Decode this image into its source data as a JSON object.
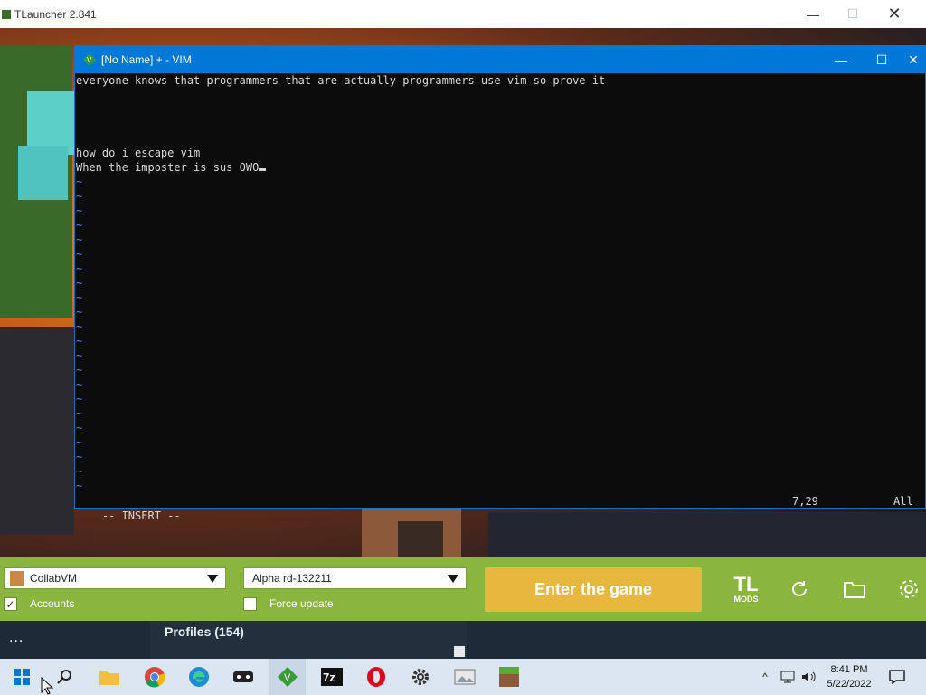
{
  "tlauncher": {
    "title": "TLauncher 2.841",
    "account_select": "CollabVM",
    "accounts_label": "Accounts",
    "accounts_checked": true,
    "version_select": "Alpha rd-132211",
    "force_update_label": "Force update",
    "force_update_checked": false,
    "enter_button": "Enter the game",
    "mods_logo_text": "TL",
    "mods_logo_sub": "MODS",
    "profiles_title": "Profiles (154)",
    "more_label": "..."
  },
  "vim": {
    "title": "[No Name] + - VIM",
    "lines": [
      "everyone knows that programmers that are actually programmers use vim so prove it",
      "",
      "",
      "",
      "",
      "how do i escape vim",
      "When the imposter is sus OWO"
    ],
    "tilde_count": 22,
    "mode": "-- INSERT --",
    "position": "7,29",
    "scroll": "All"
  },
  "taskbar": {
    "time": "8:41 PM",
    "date": "5/22/2022",
    "apps": [
      "file-explorer",
      "chrome",
      "edge",
      "game-controller",
      "vim",
      "7zip",
      "opera",
      "settings",
      "photo-viewer",
      "minecraft"
    ]
  },
  "colors": {
    "launcher_green": "#8ab53f",
    "enter_yellow": "#e8b73d",
    "vim_title_blue": "#0078d7",
    "vim_bg": "#0c0c0c",
    "tilde_blue": "#5a7bff"
  }
}
